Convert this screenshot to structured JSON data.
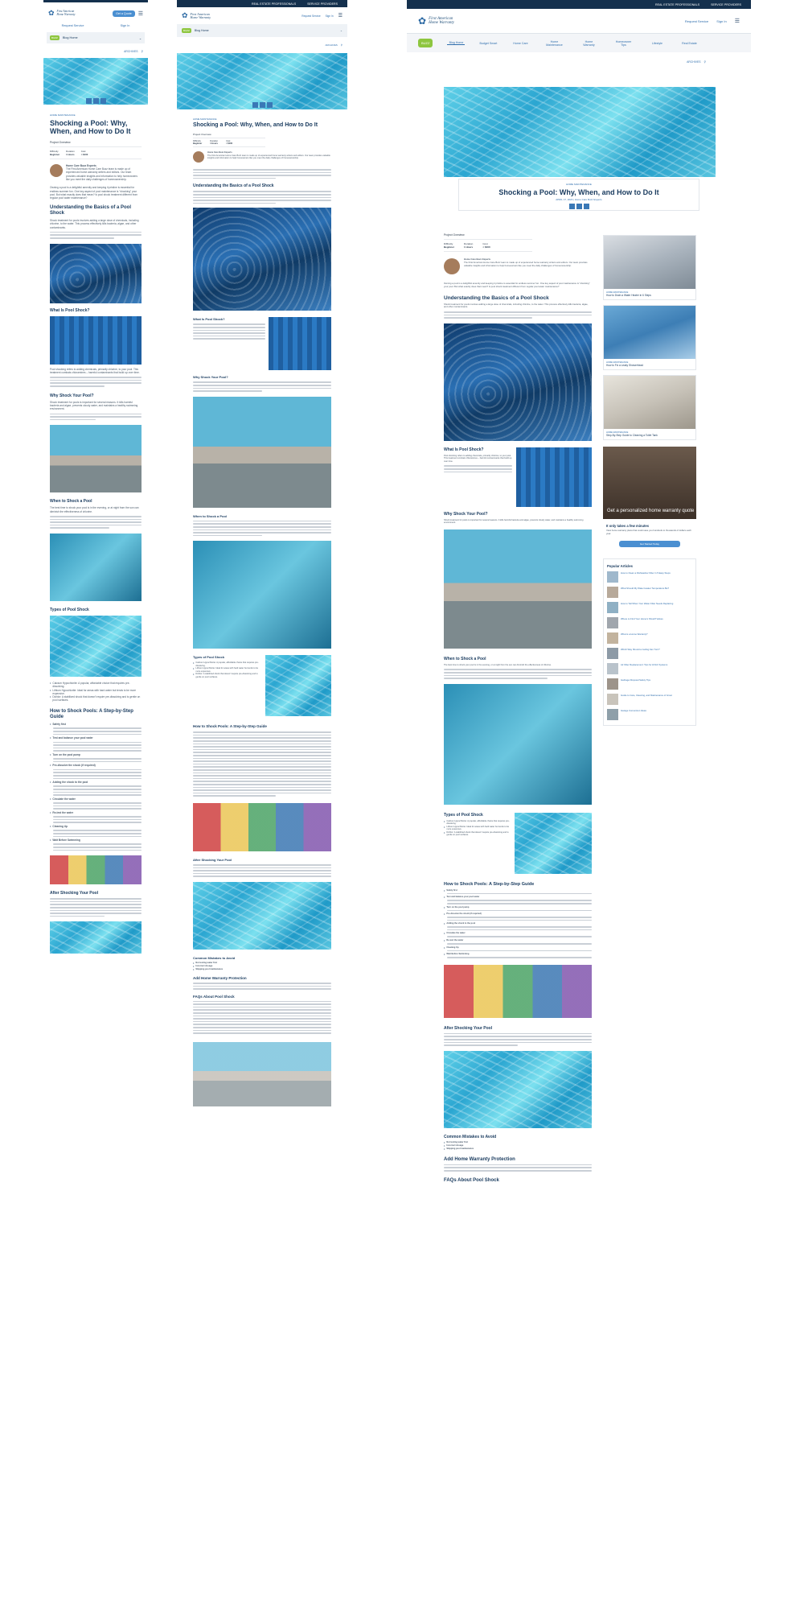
{
  "brand": {
    "logo_line1": "First American",
    "logo_line2": "Home Warranty",
    "buzz_badge": "BUZZ"
  },
  "topbar": {
    "real_estate": "REAL ESTATE PROFESSIONALS",
    "service_providers": "SERVICE PROVIDERS"
  },
  "header": {
    "get_quote": "Get a Quote",
    "request_service": "Request Service",
    "sign_in": "Sign In",
    "blog_home": "Blog Home",
    "archives": "ARCHIVES"
  },
  "nav": [
    "Blog Home",
    "Budget Smart",
    "Home Care",
    "Home Maintenance",
    "Home Warranty",
    "Homeowner Tips",
    "Lifestyle",
    "Real Estate"
  ],
  "article": {
    "category": "HOME MAINTENANCE",
    "title": "Shocking a Pool: Why, When, and How to Do It",
    "date": "APRIL 17, 2024",
    "byline": "Home Care Buzz Experts",
    "project_overview": "Project Overview",
    "difficulty_label": "Difficulty",
    "difficulty_value": "Beginner",
    "duration_label": "Duration",
    "duration_value": "1 Hours",
    "cost_label": "Cost",
    "cost_value": "< $100",
    "author_name": "Home Care Buzz Experts",
    "author_bio": "The First American Home Care Buzz team is made up of experienced home warranty writers and editors. Our team provides valuable insights and information to help homeowners like you meet the daily challenges of homeownership.",
    "intro": "Owning a pool is a delightful amenity and keeping it pristine is essential for endless summer fun. One key aspect of pool maintenance is \"shocking\" your pool. But what exactly does that mean? Is pool shock treatment different from regular pool water maintenance?",
    "h_basics": "Understanding the Basics of a Pool Shock",
    "basics_text": "Shock treatment for pools involves adding a large dose of chemicals, including chlorine, to the water. This process effectively kills bacteria, algae, and other contaminants.",
    "h_what": "What Is Pool Shock?",
    "what_text": "Pool shocking refers to adding chemicals, primarily chlorine, to your pool. This treatment combats chloramines – harmful contaminants that build up over time.",
    "h_why": "Why Shock Your Pool?",
    "why_text": "Shock treatment for pools is important for several reasons. It kills harmful bacteria and algae, prevents cloudy water, and maintains a healthy swimming environment.",
    "h_when": "When to Shock a Pool",
    "when_text": "The best time to shock your pool is in the evening, or at night from the sun can diminish the effectiveness of chlorine.",
    "h_types": "Types of Pool Shock",
    "types": [
      "Calcium Hypochlorite: A popular, affordable choice that requires pre-dissolving.",
      "Lithium Hypochlorite: Ideal for areas with hard water but tends to be more expensive.",
      "Dichlor: A stabilized shock that doesn't require pre-dissolving and is gentle on pool surfaces."
    ],
    "h_steps": "How to Shock Pools: A Step-by-Step Guide",
    "steps": [
      "Safety first",
      "Test and balance your pool water",
      "Turn on the pool pump",
      "Pre-dissolve the shock (if required)",
      "Adding the shock to the pool",
      "Circulate the water",
      "Re-test the water",
      "Cleaning Up",
      "Wait Before Swimming"
    ],
    "h_after": "After Shocking Your Pool",
    "h_mistakes": "Common Mistakes to Avoid",
    "mistakes": [
      "Not testing water first",
      "Incorrect dosage",
      "Skipping pool maintenance"
    ],
    "h_warranty": "Add Home Warranty Protection",
    "h_faq": "FAQs About Pool Shock"
  },
  "sidebar": {
    "cards": [
      {
        "category": "HOME MAINTENANCE",
        "title": "How to Drain a Water Heater in 6 Steps"
      },
      {
        "category": "HOME MAINTENANCE",
        "title": "How to Fix a Leaky Showerhead"
      },
      {
        "category": "HOME MAINTENANCE",
        "title": "Step-By-Step Guide to Cleaning a Toilet Tank"
      }
    ],
    "promo_title": "Get a personalized home warranty quote",
    "promo_sub": "It only takes a few minutes",
    "promo_text": "View home warranty plans that could save you hundreds to thousands of dollars each year.",
    "promo_button": "Get Started Today",
    "popular_title": "Popular Articles",
    "popular": [
      "How to Clean a Dishwasher Filter in 5 Easy Steps",
      "What Should My Water Heater Temperature Be?",
      "How to Tell When Your Water Filter Needs Replacing",
      "Where to Find Your Home's Shutoff Valves",
      "What is a Home Warranty?",
      "Which Way Should a Ceiling Fan Turn?",
      "Air Filter Replacement: Tips for HVAC Systems",
      "Garbage Disposal Safety Tips",
      "Guide to Care, Cleaning, and Maintenance of Grout",
      "Garage Conversion Ideas"
    ]
  },
  "colors": {
    "navy": "#14304d",
    "accent": "#4a8fd1",
    "heading": "#1d3e61",
    "link": "#2f6ead"
  }
}
